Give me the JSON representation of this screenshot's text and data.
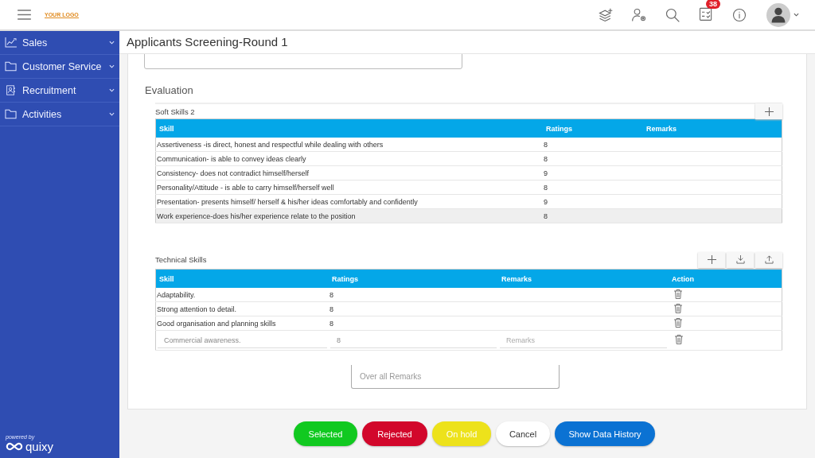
{
  "logo": "YOUR LOGO",
  "notifications": {
    "count": "38"
  },
  "sidebar": {
    "items": [
      {
        "label": "Sales",
        "kind": "chart"
      },
      {
        "label": "Customer Service",
        "kind": "folder"
      },
      {
        "label": "Recruitment",
        "kind": "contact"
      },
      {
        "label": "Activities",
        "kind": "folder"
      }
    ],
    "powered_by": "powered by",
    "brand": "quixy"
  },
  "page_title": "Applicants Screening-Round 1",
  "section_title": "Evaluation",
  "soft_skills": {
    "title": "Soft Skills 2",
    "columns": [
      "Skill",
      "Ratings",
      "Remarks"
    ],
    "rows": [
      {
        "skill": "Assertiveness -is direct, honest and respectful while dealing with others",
        "rating": "8",
        "selected": false
      },
      {
        "skill": "Communication- is able to convey ideas clearly",
        "rating": "8",
        "selected": false
      },
      {
        "skill": "Consistency- does not contradict himself/herself",
        "rating": "9",
        "selected": false
      },
      {
        "skill": "Personality/Attitude - is able to carry himself/herself well",
        "rating": "8",
        "selected": false
      },
      {
        "skill": "Presentation- presents himself/ herself & his/her ideas comfortably and confidently",
        "rating": "9",
        "selected": false
      },
      {
        "skill": "Work experience-does his/her experience relate to the position",
        "rating": "8",
        "selected": true
      }
    ]
  },
  "technical_skills": {
    "title": "Technical Skills",
    "columns": [
      "Skill",
      "Ratings",
      "Remarks",
      "Action"
    ],
    "rows": [
      {
        "skill": "Adaptability.",
        "rating": "8"
      },
      {
        "skill": "Strong attention to detail.",
        "rating": "8"
      },
      {
        "skill": "Good organisation and planning skills",
        "rating": "8"
      }
    ],
    "edit_row": {
      "skill": "Commercial awareness.",
      "rating": "8",
      "remarks_placeholder": "Remarks"
    }
  },
  "overall_remarks": {
    "placeholder": "Over all Remarks"
  },
  "buttons": [
    {
      "label": "Selected",
      "kind": "green"
    },
    {
      "label": "Rejected",
      "kind": "red"
    },
    {
      "label": "On hold",
      "kind": "yellow"
    },
    {
      "label": "Cancel",
      "kind": "plain"
    },
    {
      "label": "Show Data History",
      "kind": "blue"
    }
  ]
}
